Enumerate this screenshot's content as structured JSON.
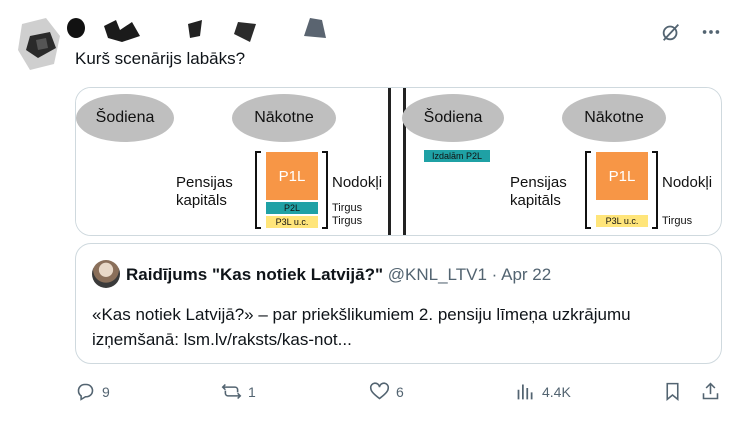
{
  "post": {
    "text": "Kurš scenārijs labāks?"
  },
  "icons": {
    "grok": "grok-icon",
    "more": "more-icon",
    "reply": "reply-icon",
    "repost": "repost-icon",
    "like": "like-icon",
    "views": "views-icon",
    "bookmark": "bookmark-icon",
    "share": "share-icon"
  },
  "media": {
    "left": {
      "today": "Šodiena",
      "future": "Nākotne",
      "pension_line1": "Pensijas",
      "pension_line2": "kapitāls",
      "p1l": "P1L",
      "p2l": "P2L",
      "p3l": "P3L u.c.",
      "taxes": "Nodokļi",
      "market1": "Tirgus",
      "market2": "Tirgus"
    },
    "right": {
      "today": "Šodiena",
      "future": "Nākotne",
      "payout": "Izdalām P2L",
      "pension_line1": "Pensijas",
      "pension_line2": "kapitāls",
      "p1l": "P1L",
      "p3l": "P3L u.c.",
      "taxes": "Nodokļi",
      "market": "Tirgus"
    }
  },
  "quote": {
    "name": "Raidījums \"Kas notiek Latvijā?\"",
    "handle": "@KNL_LTV1",
    "separator": "·",
    "date": "Apr 22",
    "body": "«Kas notiek Latvijā?» – par priekšlikumiem 2. pensiju līmeņa uzkrājumu izņemšanā:  lsm.lv/raksts/kas-not..."
  },
  "actions": {
    "replies": "9",
    "reposts": "1",
    "likes": "6",
    "views": "4.4K"
  },
  "colors": {
    "p1l": "#f79646",
    "p2l": "#1fa1a5",
    "p3l": "#ffe57a",
    "ellipse": "#bfbfbf",
    "muted": "#536471",
    "border": "#cfd9de"
  }
}
